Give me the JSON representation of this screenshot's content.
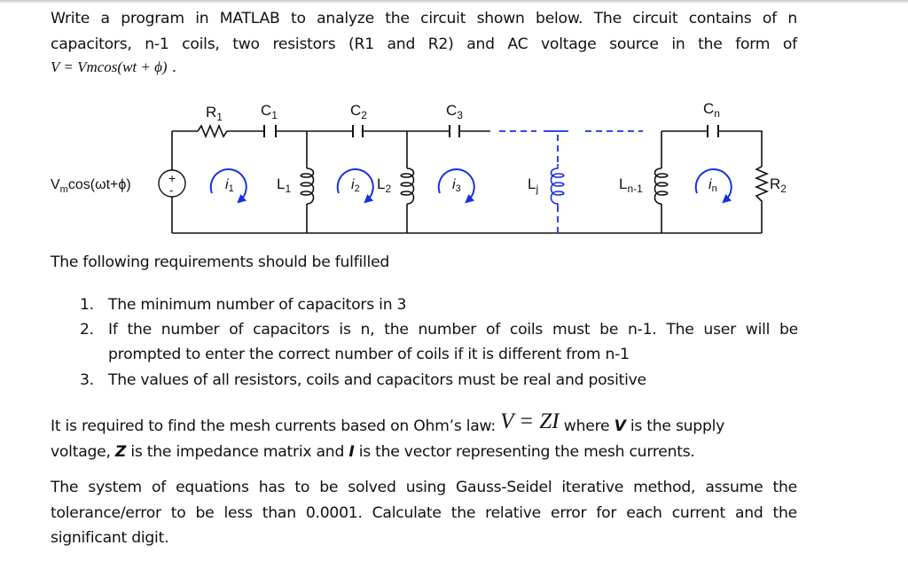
{
  "intro": {
    "lines": [
      "Write a program in MATLAB to analyze the circuit shown below. The circuit contains of n",
      "capacitors, n-1 coils, two resistors (R1 and R2) and AC voltage source in the form of"
    ],
    "formula": {
      "lhs": "V",
      "eq": " = ",
      "vm": "Vm",
      "cos": "cos",
      "arg": "(wt + ",
      "phi": "ϕ",
      "close": ")",
      "end": " ."
    }
  },
  "circuit": {
    "source_label": "Vmcos(ωt+ϕ)",
    "source_label_parts": {
      "v": "V",
      "sub": "m",
      "rest": "cos(ωt+ϕ)"
    },
    "source_plus": "+",
    "source_minus": "-",
    "resistors": [
      {
        "id": "R1",
        "base": "R",
        "sub": "1"
      },
      {
        "id": "R2",
        "base": "R",
        "sub": "2"
      }
    ],
    "capacitors": [
      {
        "id": "C1",
        "base": "C",
        "sub": "1"
      },
      {
        "id": "C2",
        "base": "C",
        "sub": "2"
      },
      {
        "id": "C3",
        "base": "C",
        "sub": "3"
      },
      {
        "id": "Cn",
        "base": "C",
        "sub": "n"
      }
    ],
    "coils": [
      {
        "id": "L1",
        "base": "L",
        "sub": "1"
      },
      {
        "id": "L2",
        "base": "L",
        "sub": "2"
      },
      {
        "id": "Lj",
        "base": "L",
        "sub": "j"
      },
      {
        "id": "Ln-1",
        "base": "L",
        "sub": "n-1"
      }
    ],
    "mesh_currents": [
      {
        "id": "i1",
        "base": "i",
        "sub": "1"
      },
      {
        "id": "i2",
        "base": "i",
        "sub": "2"
      },
      {
        "id": "i3",
        "base": "i",
        "sub": "3"
      },
      {
        "id": "in",
        "base": "i",
        "sub": "n"
      }
    ],
    "colors": {
      "wire": "#111111",
      "highlight": "#1a2fe0"
    }
  },
  "requirements": {
    "heading": "The following requirements should be fulfilled",
    "items": [
      {
        "num": "1.",
        "lines": [
          "The minimum number of capacitors in 3"
        ]
      },
      {
        "num": "2.",
        "lines": [
          "If the number of capacitors is n, the number of coils must be n-1. The user will be",
          "prompted to enter the correct number of coils if it is different from n-1"
        ]
      },
      {
        "num": "3.",
        "lines": [
          "The values of all resistors, coils and capacitors must be real and positive"
        ]
      }
    ]
  },
  "ohm": {
    "pre": "It is required to find the mesh currents based on Ohm’s law: ",
    "equation": "V = ZI",
    "mid1": " where ",
    "v": "V",
    "mid2": " is the supply",
    "line2_pre": "voltage, ",
    "z": "Z",
    "line2_mid": " is the impedance matrix and ",
    "i": "I",
    "line2_end": " is the vector representing the mesh currents."
  },
  "method": {
    "lines": [
      "The system of equations has to be solved using Gauss-Seidel iterative method, assume the",
      "tolerance/error to be less than 0.0001. Calculate the relative error for each current and the",
      "significant digit."
    ]
  }
}
